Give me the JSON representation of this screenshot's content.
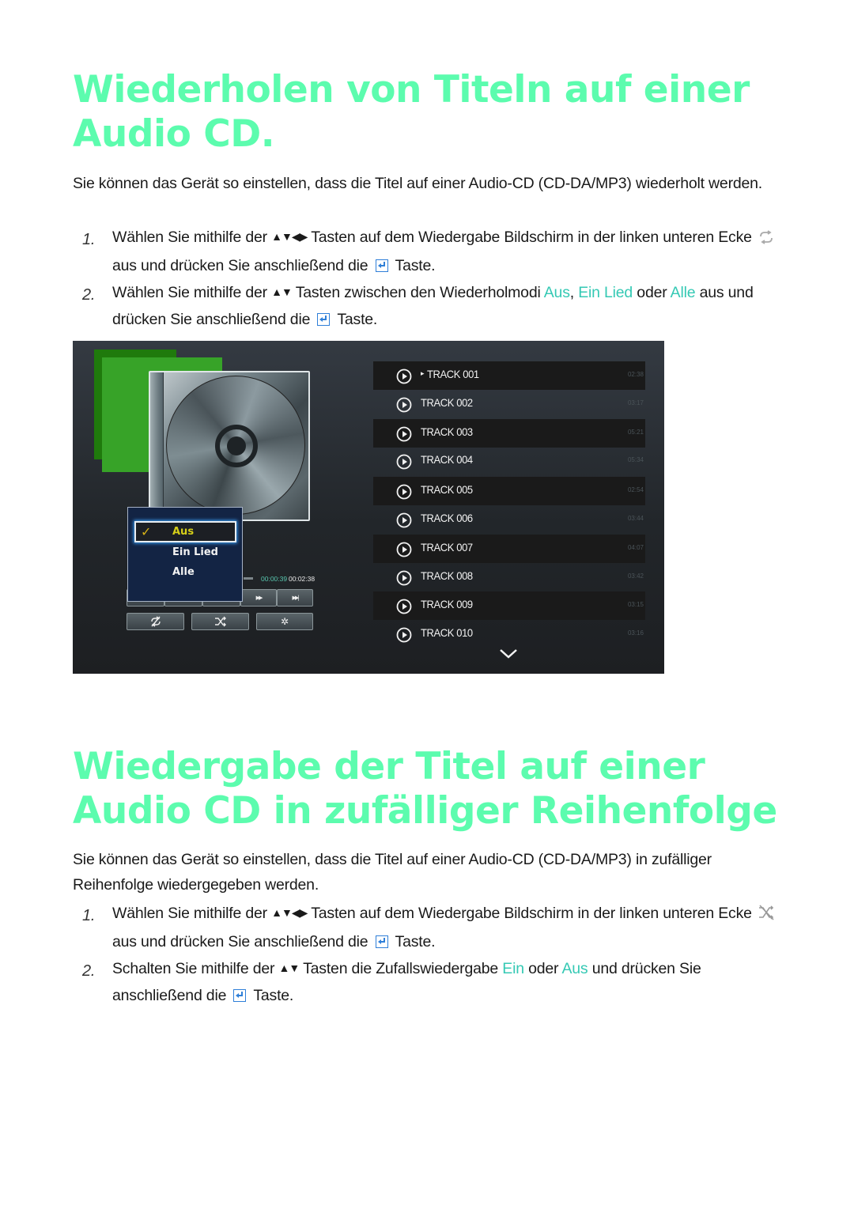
{
  "section1": {
    "title": "Wiederholen von Titeln auf einer Audio CD.",
    "intro": "Sie können das Gerät so einstellen, dass die Titel auf einer Audio-CD (CD-DA/MP3) wiederholt werden.",
    "steps": [
      {
        "number": "1.",
        "part1": "Wählen Sie mithilfe der ",
        "arrows": "▲▼◀▶",
        "part2": " Tasten auf dem Wiedergabe Bildschirm in der linken unteren Ecke ",
        "icon": "repeat-icon",
        "part3": " aus und drücken Sie anschließend die ",
        "key_icon": "enter-key-icon",
        "part4": " Taste."
      },
      {
        "number": "2.",
        "part1": "Wählen Sie mithilfe der ",
        "arrows": "▲▼",
        "part2": " Tasten zwischen den Wiederholmodi ",
        "opt1": "Aus",
        "sep1": ", ",
        "opt2": "Ein Lied",
        "sep2": " oder ",
        "opt3": "Alle",
        "part3": " aus und drücken Sie anschließend die ",
        "key_icon": "enter-key-icon",
        "part4": " Taste."
      }
    ]
  },
  "screenshot": {
    "repeat_menu": {
      "options": [
        "Aus",
        "Ein Lied",
        "Alle"
      ],
      "selected": "Aus"
    },
    "time_current": "00:00:39",
    "time_total": "00:02:38",
    "controls": {
      "row1": [
        "",
        "",
        "",
        "fast-forward",
        "skip-next"
      ],
      "row2": [
        "repeat-off",
        "shuffle",
        "settings"
      ],
      "ff_glyph": "▶▶",
      "next_glyph": "▶▶|",
      "settings_glyph": "✲"
    },
    "tracks": [
      {
        "name": "TRACK 001",
        "duration": "02:38",
        "playing": true,
        "marker": "▸"
      },
      {
        "name": "TRACK 002",
        "duration": "03:17"
      },
      {
        "name": "TRACK 003",
        "duration": "05:21"
      },
      {
        "name": "TRACK 004",
        "duration": "05:34"
      },
      {
        "name": "TRACK 005",
        "duration": "02:54"
      },
      {
        "name": "TRACK 006",
        "duration": "03:44"
      },
      {
        "name": "TRACK 007",
        "duration": "04:07"
      },
      {
        "name": "TRACK 008",
        "duration": "03:42"
      },
      {
        "name": "TRACK 009",
        "duration": "03:15"
      },
      {
        "name": "TRACK 010",
        "duration": "03:16"
      }
    ]
  },
  "section2": {
    "title": "Wiedergabe der Titel auf einer Audio CD in zufälliger Reihenfolge",
    "intro": "Sie können das Gerät so einstellen, dass die Titel auf einer Audio-CD (CD-DA/MP3) in zufälliger Reihenfolge wiedergegeben werden.",
    "steps": [
      {
        "number": "1.",
        "part1": "Wählen Sie mithilfe der ",
        "arrows": "▲▼◀▶",
        "part2": " Tasten auf dem Wiedergabe Bildschirm in der linken unteren Ecke ",
        "icon": "shuffle-icon",
        "part3": " aus und drücken Sie anschließend die ",
        "key_icon": "enter-key-icon",
        "part4": " Taste."
      },
      {
        "number": "2.",
        "part1": "Schalten Sie mithilfe der ",
        "arrows": "▲▼",
        "part2": " Tasten die Zufallswiedergabe ",
        "opt1": "Ein",
        "sep1": " oder ",
        "opt2": "Aus",
        "part3": " und drücken Sie anschließend die ",
        "key_icon": "enter-key-icon",
        "part4": " Taste."
      }
    ]
  },
  "colors": {
    "heading": "#5cfcae",
    "highlight": "#35c9b4",
    "enter_key": "#2f7fd8",
    "menu_bg": "#132444",
    "menu_active": "#d6cf19",
    "green_tile": "#37a328"
  }
}
